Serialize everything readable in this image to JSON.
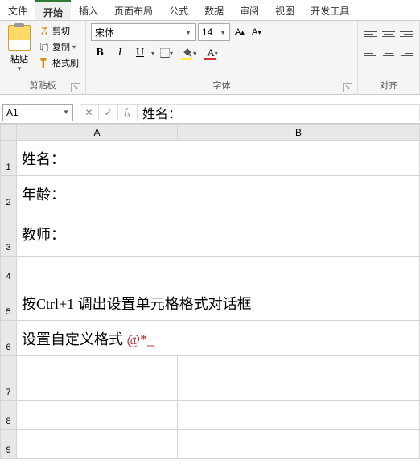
{
  "menu": {
    "items": [
      "文件",
      "开始",
      "插入",
      "页面布局",
      "公式",
      "数据",
      "审阅",
      "视图",
      "开发工具"
    ],
    "active_index": 1
  },
  "ribbon": {
    "clipboard": {
      "paste": "粘贴",
      "cut": "剪切",
      "copy": "复制",
      "format_painter": "格式刷",
      "group_label": "剪贴板"
    },
    "font": {
      "name": "宋体",
      "size": "14",
      "bold": "B",
      "italic": "I",
      "underline": "U",
      "font_a": "A",
      "group_label": "字体"
    },
    "alignment": {
      "group_label": "对齐"
    }
  },
  "name_box": "A1",
  "formula_value": "姓名：",
  "columns": [
    "A",
    "B"
  ],
  "rows": [
    {
      "num": "1",
      "a": "姓名：",
      "b": ""
    },
    {
      "num": "2",
      "a": "年龄：",
      "b": ""
    },
    {
      "num": "3",
      "a": "教师：",
      "b": ""
    },
    {
      "num": "4",
      "a": "",
      "b": ""
    },
    {
      "num": "5",
      "a": "按Ctrl+1 调出设置单元格格式对话框",
      "b": ""
    },
    {
      "num": "6",
      "a_pre": "设置自定义格式 ",
      "a_code": "@*_",
      "b": ""
    },
    {
      "num": "7",
      "a": "",
      "b": ""
    },
    {
      "num": "8",
      "a": "",
      "b": ""
    },
    {
      "num": "9",
      "a": "",
      "b": ""
    }
  ]
}
